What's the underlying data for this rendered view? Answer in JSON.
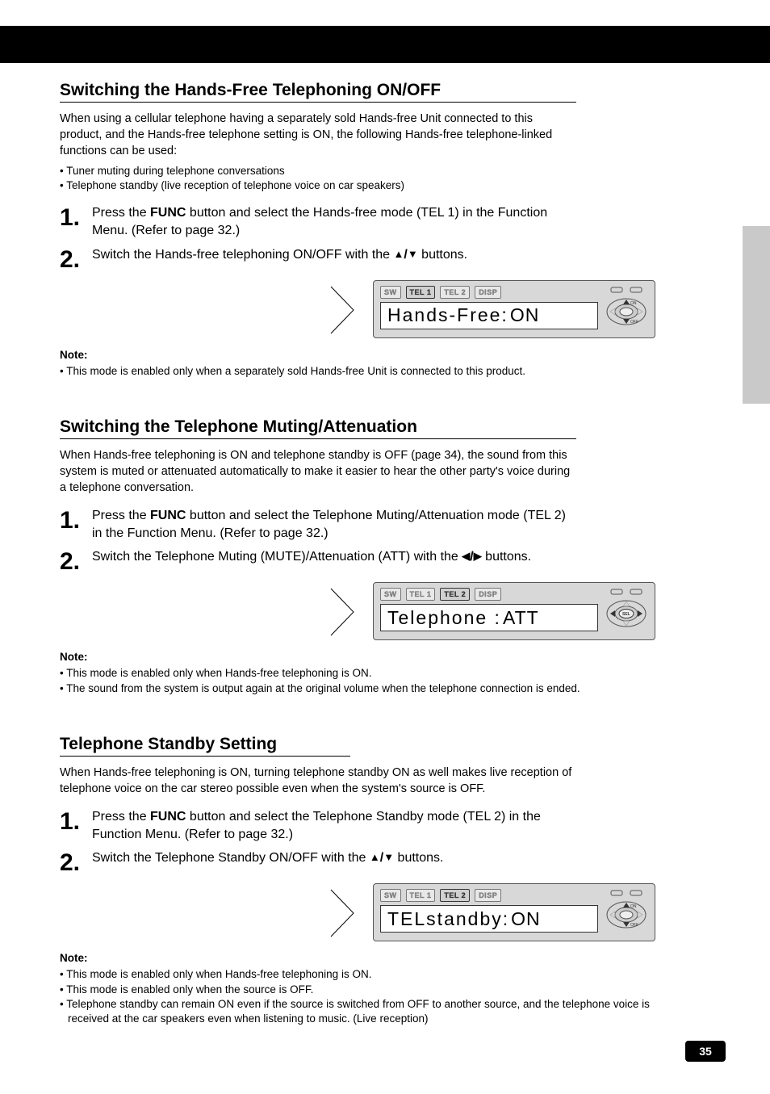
{
  "page_number": "35",
  "sections": [
    {
      "title": "Switching the Hands-Free Telephoning ON/OFF",
      "intro": "When using a cellular telephone having a separately sold Hands-free Unit connected to this product, and the Hands-free telephone setting is ON, the following Hands-free telephone-linked functions can be used:",
      "intro_bullets": [
        "• Tuner muting during telephone conversations",
        "• Telephone standby (live reception of telephone voice on car speakers)"
      ],
      "step1": {
        "txt1": "Press the ",
        "btn": "FUNC",
        "txt2": " button and select the Hands-free mode (TEL 1) in the Function Menu. (Refer to page 32.)"
      },
      "step2": {
        "txt1": "Switch the Hands-free telephoning ON/OFF with the ",
        "btn": "5",
        "btn2": "∞",
        "txt2": " buttons."
      },
      "device": {
        "segs": [
          "SW",
          "TEL 1",
          "TEL 2",
          "DISP"
        ],
        "active": 1,
        "lcd_main": "Hands-Free:",
        "lcd_val": "ON",
        "knob": "updown"
      },
      "note_title": "Note:",
      "note_body": "• This mode is enabled only when a separately sold Hands-free Unit is connected to this product."
    },
    {
      "title": "Switching the Telephone Muting/Attenuation",
      "intro": "When Hands-free telephoning is ON and telephone standby is OFF (page 34), the sound from this system is muted or attenuated automatically to make it easier to hear the other party's voice during a telephone conversation.",
      "step1": {
        "txt1": "Press the ",
        "btn": "FUNC",
        "txt2": " button and select the Telephone Muting/Attenuation mode (TEL 2) in the Function Menu. (Refer to page 32.)"
      },
      "step2": {
        "txt1": "Switch the Telephone Muting (MUTE)/Attenuation (ATT) with the ",
        "btn": "2",
        "btn2": "3",
        "txt2": " buttons."
      },
      "device": {
        "segs": [
          "SW",
          "TEL 1",
          "TEL 2",
          "DISP"
        ],
        "active": 2,
        "lcd_main": "Telephone  :",
        "lcd_val": "ATT",
        "knob": "leftright"
      },
      "note_title": "Note:",
      "note_bullets": [
        "• This mode is enabled only when Hands-free telephoning is ON.",
        "• The sound from the system is output again at the original volume when the telephone connection is ended."
      ]
    },
    {
      "title": "Telephone Standby Setting",
      "intro": "When Hands-free telephoning is ON, turning telephone standby ON as well makes live reception of telephone voice on the car stereo possible even when the system's source is OFF.",
      "step1": {
        "txt1": "Press the ",
        "btn": "FUNC",
        "txt2": " button and select the Telephone Standby mode (TEL 2) in the Function Menu. (Refer to page 32.)"
      },
      "step2": {
        "txt1": "Switch the Telephone Standby ON/OFF with the ",
        "btn": "5",
        "btn2": "∞",
        "txt2": " buttons."
      },
      "device": {
        "segs": [
          "SW",
          "TEL 1",
          "TEL 2",
          "DISP"
        ],
        "active": 2,
        "lcd_main": "TELstandby:",
        "lcd_val": "ON",
        "knob": "updown"
      },
      "note_title": "Note:",
      "note_bullets": [
        "• This mode is enabled only when Hands-free telephoning is ON.",
        "• This mode is enabled only when the source is OFF.",
        "• Telephone standby can remain ON even if the source is switched from OFF to another source, and the telephone voice is received at the car speakers even when listening to music. (Live reception)"
      ]
    }
  ]
}
